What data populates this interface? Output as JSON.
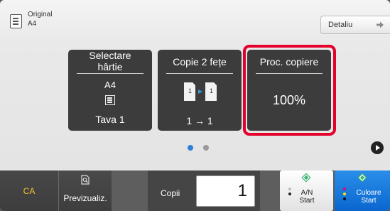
{
  "header": {
    "original_label": "Original",
    "original_size": "A4",
    "detail_button": "Detaliu"
  },
  "tiles": {
    "paper": {
      "title": "Selectare hârtie",
      "size": "A4",
      "tray": "Tava 1"
    },
    "duplex": {
      "title": "Copie 2 fețe",
      "mode": "1 → 1"
    },
    "ratio": {
      "title": "Proc. copiere",
      "value": "100%"
    }
  },
  "pager": {
    "pages": 2,
    "current": 1
  },
  "footer": {
    "ca_label": "CA",
    "preview_label": "Previzualiz.",
    "copies_label": "Copii",
    "copies_value": "1",
    "bw_start_line1": "A/N",
    "bw_start_line2": "Start",
    "color_start_line1": "Culoare",
    "color_start_line2": "Start"
  },
  "colors": {
    "highlight": "#e4002b",
    "ca_text": "#f2c12e",
    "color_start_bg": "#0a66cf",
    "page_dot_active": "#2f7fd6",
    "start_diamond": "#3cb371"
  },
  "icons": {
    "original": "original-document-icon",
    "detail": "arrow-right-icon",
    "tray": "paper-tray-icon",
    "duplex": "duplex-copy-icon",
    "preview": "preview-magnifier-icon",
    "next_page": "next-page-icon",
    "start": "start-diamond-icon"
  }
}
